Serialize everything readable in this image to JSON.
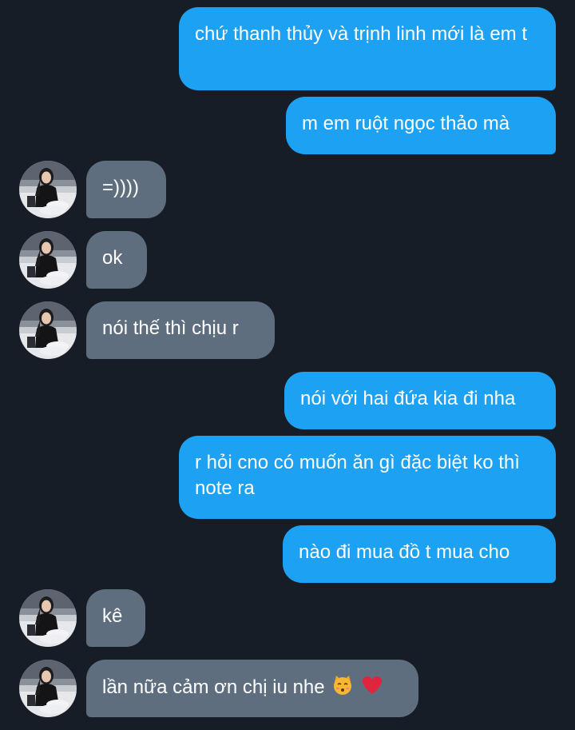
{
  "messages": [
    {
      "direction": "sent",
      "text": "chứ thanh thủy và trịnh linh mới là em t"
    },
    {
      "direction": "sent",
      "text": "m em ruột ngọc thảo mà"
    },
    {
      "direction": "received",
      "text": "=))))"
    },
    {
      "direction": "received",
      "text": "ok"
    },
    {
      "direction": "received",
      "text": "nói thế thì chịu r"
    },
    {
      "direction": "sent",
      "text": "nói với hai đứa kia đi nha"
    },
    {
      "direction": "sent",
      "text": "r hỏi cno có muốn ăn gì đặc biệt ko thì note ra"
    },
    {
      "direction": "sent",
      "text": "nào đi mua đồ t mua cho"
    },
    {
      "direction": "received",
      "text": "kê"
    },
    {
      "direction": "received",
      "text": "lần nữa cảm ơn chị iu nhe",
      "emojis": [
        "kissing-cat-emoji",
        "red-heart-emoji"
      ]
    }
  ],
  "colors": {
    "background": "#161d26",
    "sent_bubble": "#1da1f2",
    "received_bubble": "#5f6e7f",
    "text": "#ffffff"
  }
}
